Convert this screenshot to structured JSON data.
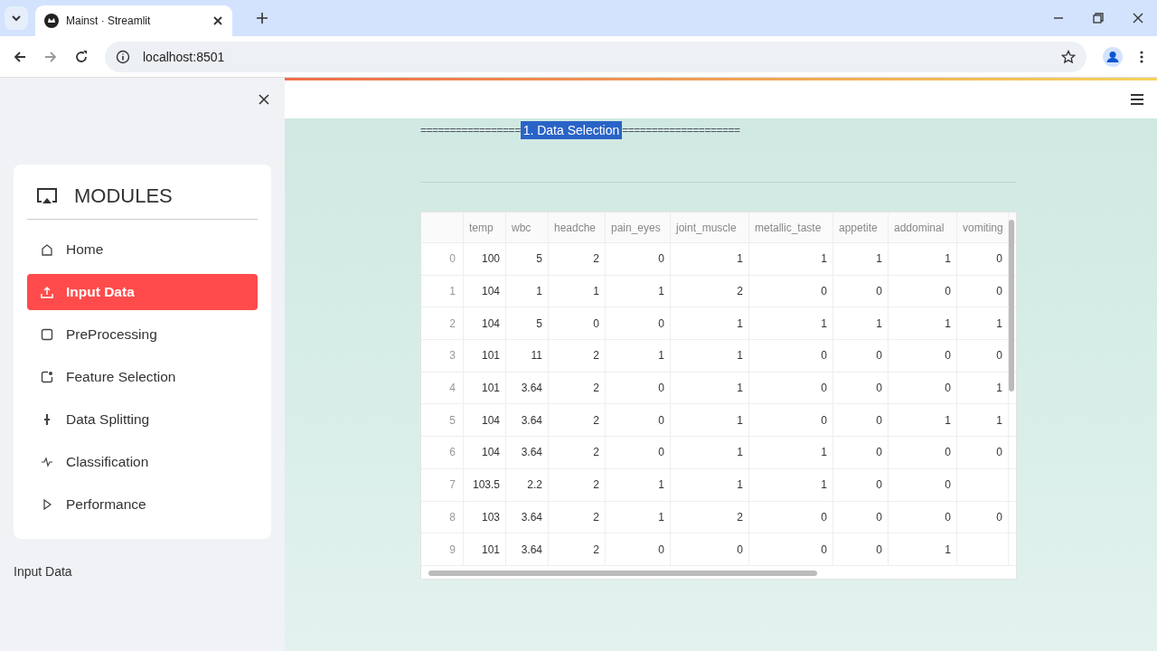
{
  "browser": {
    "tab_title": "Mainst · Streamlit",
    "url": "localhost:8501"
  },
  "sidebar": {
    "title": "MODULES",
    "items": [
      {
        "label": "Home",
        "selected": false
      },
      {
        "label": "Input Data",
        "selected": true
      },
      {
        "label": "PreProcessing",
        "selected": false
      },
      {
        "label": "Feature Selection",
        "selected": false
      },
      {
        "label": "Data Splitting",
        "selected": false
      },
      {
        "label": "Classification",
        "selected": false
      },
      {
        "label": "Performance",
        "selected": false
      }
    ],
    "caption": "Input Data"
  },
  "main": {
    "heading_left": "=================",
    "heading": "1. Data Selection",
    "heading_right": "====================",
    "table": {
      "columns": [
        "temp",
        "wbc",
        "headche",
        "pain_eyes",
        "joint_muscle",
        "metallic_taste",
        "appetite",
        "addominal",
        "vomiting"
      ],
      "rows": [
        {
          "index": "0",
          "cells": [
            "100",
            "5",
            "2",
            "0",
            "1",
            "1",
            "1",
            "1",
            "0"
          ]
        },
        {
          "index": "1",
          "cells": [
            "104",
            "1",
            "1",
            "1",
            "2",
            "0",
            "0",
            "0",
            "0"
          ]
        },
        {
          "index": "2",
          "cells": [
            "104",
            "5",
            "0",
            "0",
            "1",
            "1",
            "1",
            "1",
            "1"
          ]
        },
        {
          "index": "3",
          "cells": [
            "101",
            "11",
            "2",
            "1",
            "1",
            "0",
            "0",
            "0",
            "0"
          ]
        },
        {
          "index": "4",
          "cells": [
            "101",
            "3.64",
            "2",
            "0",
            "1",
            "0",
            "0",
            "0",
            "1"
          ]
        },
        {
          "index": "5",
          "cells": [
            "104",
            "3.64",
            "2",
            "0",
            "1",
            "0",
            "0",
            "1",
            "1"
          ]
        },
        {
          "index": "6",
          "cells": [
            "104",
            "3.64",
            "2",
            "0",
            "1",
            "1",
            "0",
            "0",
            "0"
          ]
        },
        {
          "index": "7",
          "cells": [
            "103.5",
            "2.2",
            "2",
            "1",
            "1",
            "1",
            "0",
            "0",
            null
          ]
        },
        {
          "index": "8",
          "cells": [
            "103",
            "3.64",
            "2",
            "1",
            "2",
            "0",
            "0",
            "0",
            "0"
          ]
        },
        {
          "index": "9",
          "cells": [
            "101",
            "3.64",
            "2",
            "0",
            "0",
            "0",
            "0",
            "1",
            null
          ]
        }
      ]
    }
  }
}
